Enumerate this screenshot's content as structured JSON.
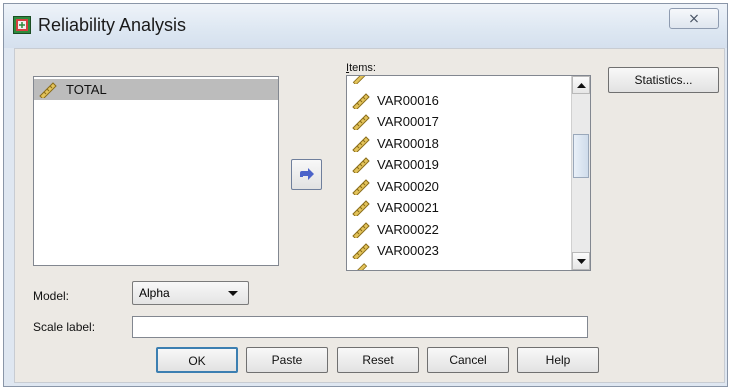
{
  "window": {
    "title": "Reliability Analysis",
    "close_glyph": "⨯"
  },
  "source_list": {
    "items": [
      "TOTAL"
    ]
  },
  "items_list": {
    "label": "Items:",
    "items": [
      "VAR00016",
      "VAR00017",
      "VAR00018",
      "VAR00019",
      "VAR00020",
      "VAR00021",
      "VAR00022",
      "VAR00023"
    ]
  },
  "statistics_button": "Statistics...",
  "model": {
    "label": "Model:",
    "value": "Alpha"
  },
  "scale_label": {
    "label": "Scale label:",
    "value": ""
  },
  "buttons": {
    "ok": "OK",
    "paste": "Paste",
    "reset": "Reset",
    "cancel": "Cancel",
    "help": "Help"
  },
  "colors": {
    "selected_row": "#bcbcbc",
    "arrow": "#4b63c9"
  }
}
